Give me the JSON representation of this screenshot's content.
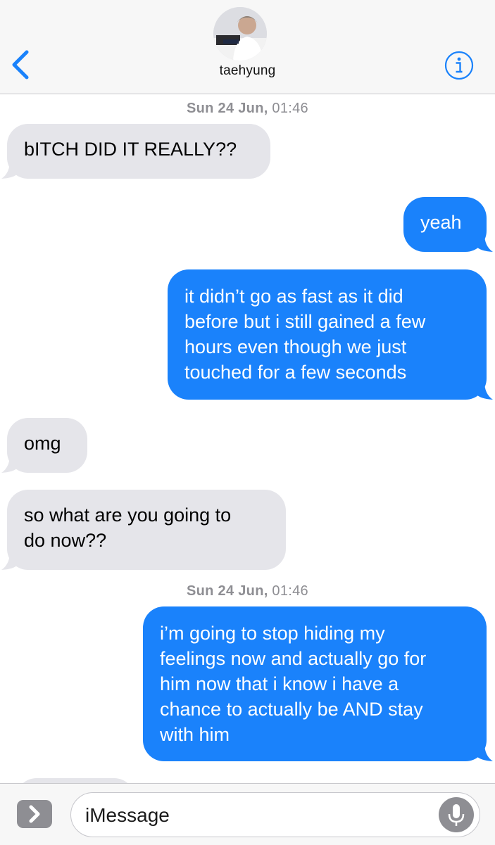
{
  "header": {
    "contact_name": "taehyung",
    "back_icon": "chevron-left-icon",
    "info_icon": "info-icon",
    "accent_color": "#1a82fb"
  },
  "timestamps": [
    {
      "day": "Sun 24 Jun,",
      "time": "01:46"
    },
    {
      "day": "Sun 24 Jun,",
      "time": "01:46"
    }
  ],
  "messages": [
    {
      "direction": "incoming",
      "lines": [
        "bITCH DID IT REALLY??"
      ]
    },
    {
      "direction": "outgoing",
      "lines": [
        "yeah"
      ]
    },
    {
      "direction": "outgoing",
      "lines": [
        "it didn’t go as fast as it did",
        "before but i still gained a few",
        "hours even though we just",
        "touched for a few seconds"
      ]
    },
    {
      "direction": "incoming",
      "lines": [
        "omg"
      ]
    },
    {
      "direction": "incoming",
      "lines": [
        "so what are you going to",
        "do now??"
      ]
    },
    {
      "direction": "outgoing",
      "lines": [
        "i’m going to stop hiding my",
        "feelings now and actually go for",
        "him now that i know i have a",
        "chance to actually be AND stay",
        "with him"
      ]
    }
  ],
  "input_bar": {
    "placeholder": "iMessage",
    "apps_icon": "chevron-right-icon",
    "mic_icon": "microphone-icon"
  }
}
